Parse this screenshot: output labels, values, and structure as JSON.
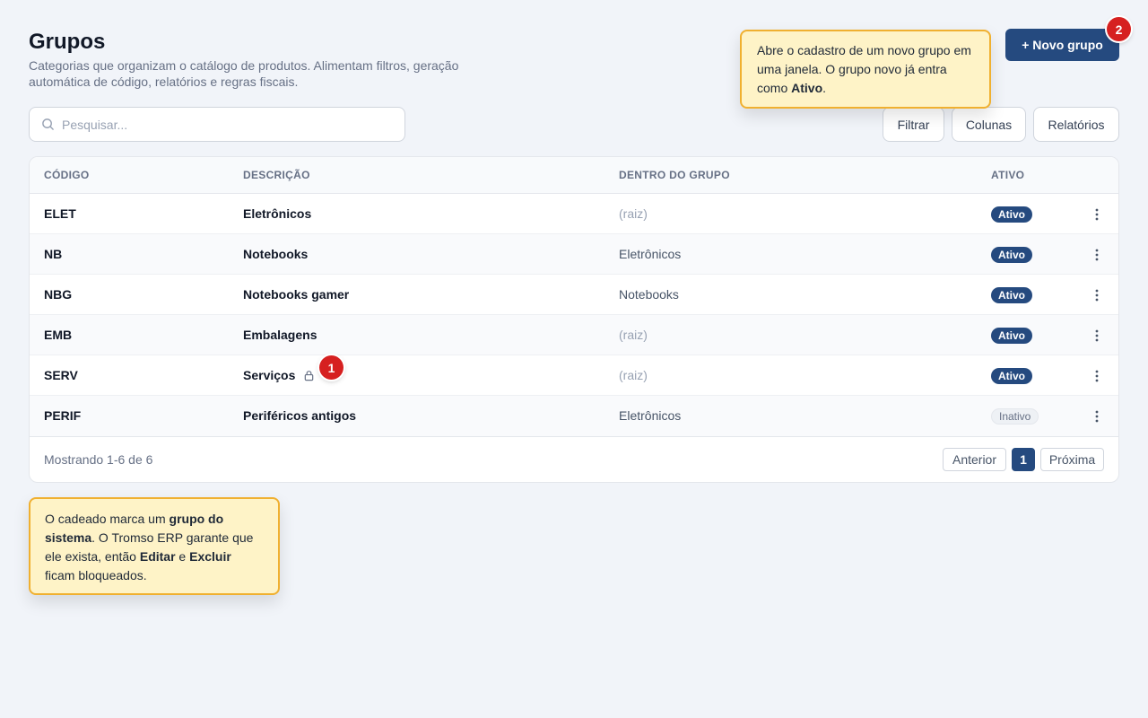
{
  "page": {
    "title": "Grupos",
    "subtitle": "Categorias que organizam o catálogo de produtos. Alimentam filtros, geração automática de código, relatórios e regras fiscais."
  },
  "actions": {
    "new_group": "+ Novo grupo"
  },
  "tooltips": {
    "top": {
      "marker": "2",
      "p1": "Abre o cadastro de um novo grupo em uma janela. O grupo novo já entra como ",
      "b1": "Ativo",
      "p2": "."
    },
    "bottom": {
      "marker": "1",
      "p1": "O cadeado marca um ",
      "b1": "grupo do sistema",
      "p2": ". O Tromso ERP garante que ele exista, então ",
      "b2": "Editar",
      "p3": " e ",
      "b3": "Excluir",
      "p4": " ficam bloqueados."
    }
  },
  "search": {
    "placeholder": "Pesquisar..."
  },
  "toolbar": {
    "filter": "Filtrar",
    "columns": "Colunas",
    "reports": "Relatórios"
  },
  "table": {
    "headers": {
      "code": "CÓDIGO",
      "description": "DESCRIÇÃO",
      "parent": "DENTRO DO GRUPO",
      "active": "ATIVO"
    },
    "rows": [
      {
        "code": "ELET",
        "description": "Eletrônicos",
        "parent": "(raiz)",
        "status": "Ativo"
      },
      {
        "code": "NB",
        "description": "Notebooks",
        "parent": "Eletrônicos",
        "status": "Ativo"
      },
      {
        "code": "NBG",
        "description": "Notebooks gamer",
        "parent": "Notebooks",
        "status": "Ativo"
      },
      {
        "code": "EMB",
        "description": "Embalagens",
        "parent": "(raiz)",
        "status": "Ativo"
      },
      {
        "code": "SERV",
        "description": "Serviços",
        "parent": "(raiz)",
        "status": "Ativo"
      },
      {
        "code": "PERIF",
        "description": "Periféricos antigos",
        "parent": "Eletrônicos",
        "status": "Inativo"
      }
    ]
  },
  "pagination": {
    "summary": "Mostrando 1-6 de 6",
    "prev": "Anterior",
    "current": "1",
    "next": "Próxima"
  },
  "colors": {
    "primary": "#254a7f",
    "marker": "#d62020",
    "tooltip_bg": "#fef3c7",
    "tooltip_border": "#f0b030"
  }
}
